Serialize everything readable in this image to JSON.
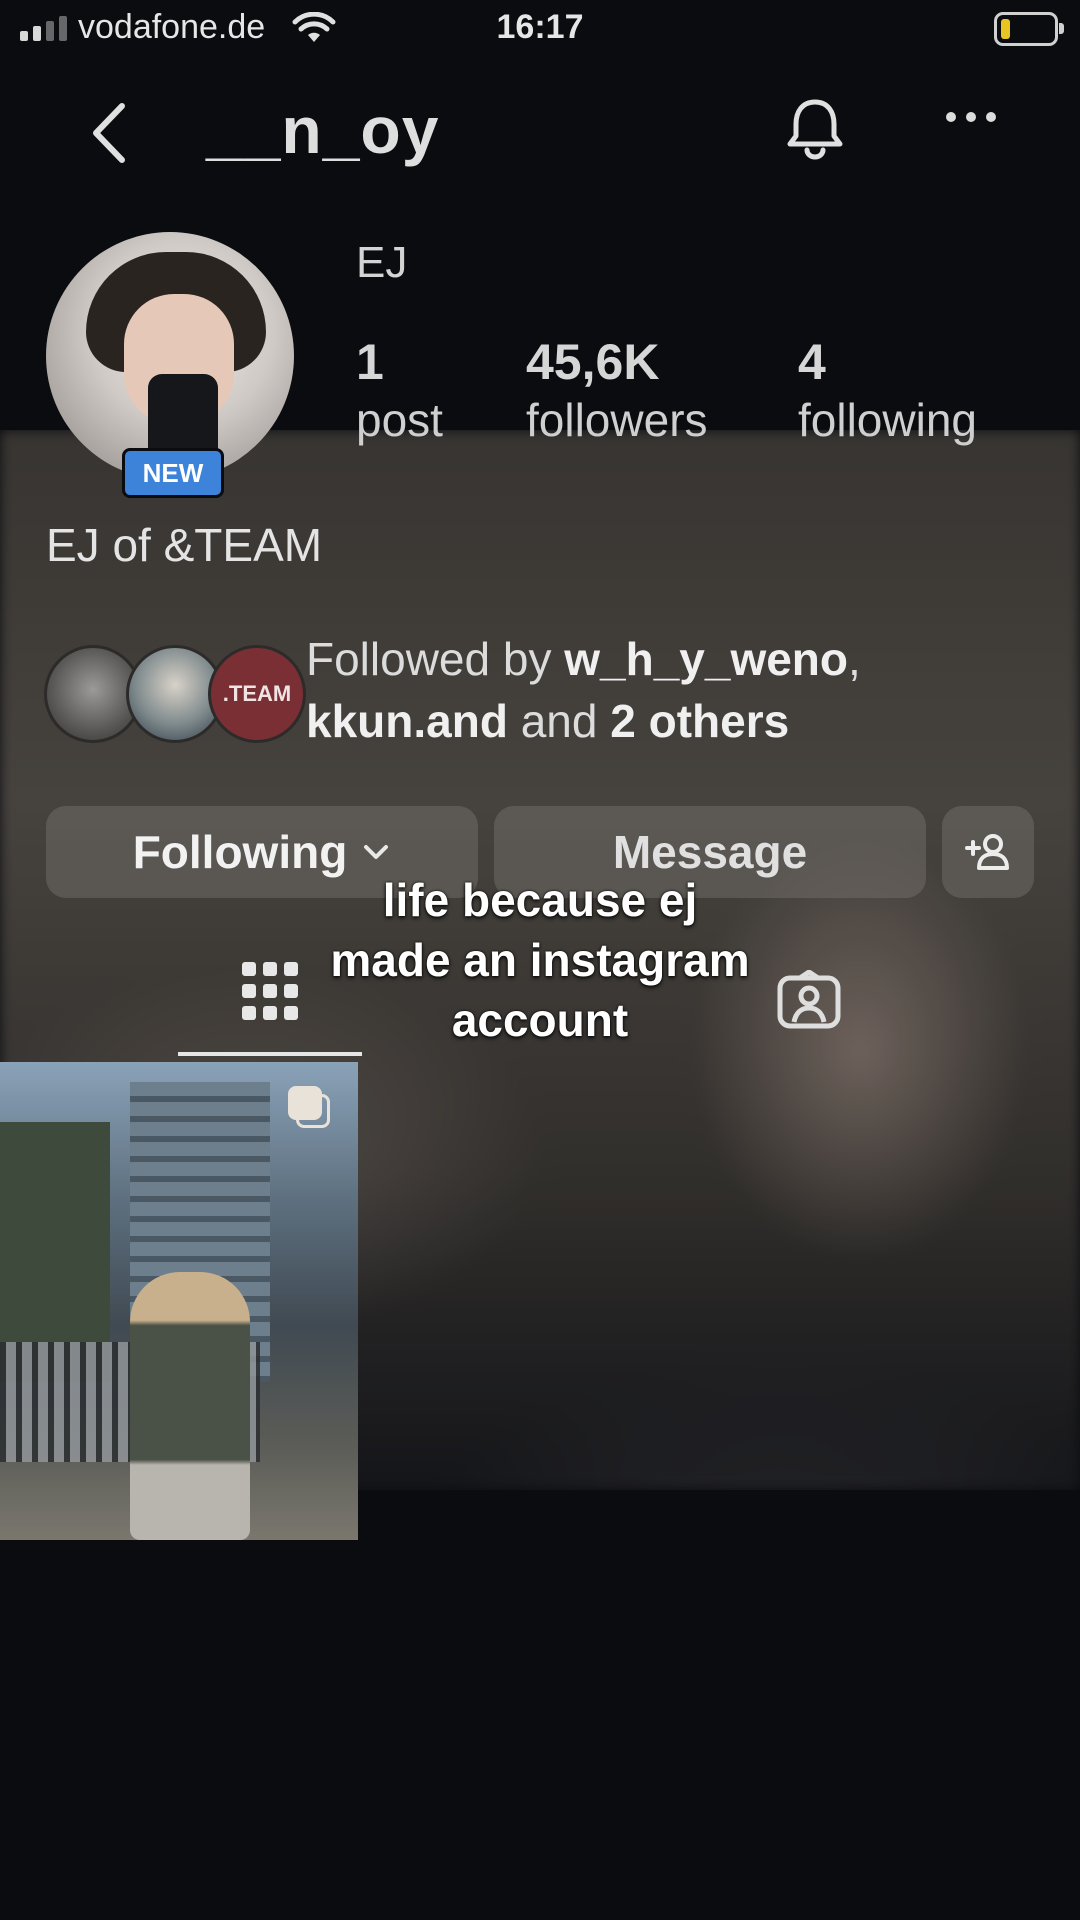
{
  "status_bar": {
    "carrier": "vodafone.de",
    "time": "16:17"
  },
  "header": {
    "username": "__n_oy"
  },
  "profile": {
    "display_name": "EJ",
    "badge": "NEW",
    "bio": "EJ of &TEAM",
    "stats": [
      {
        "value": "1",
        "label": "post"
      },
      {
        "value": "45,6K",
        "label": "followers"
      },
      {
        "value": "4",
        "label": "following"
      }
    ]
  },
  "followed_by": {
    "prefix": "Followed by ",
    "user1": "w_h_y_weno",
    "sep": ",",
    "user2": "kkun.and",
    "and": " and ",
    "others": "2 others",
    "avatar3_label": ".TEAM"
  },
  "actions": {
    "following_label": "Following",
    "message_label": "Message"
  },
  "caption": {
    "line1": "life because ej",
    "line2": "made an instagram",
    "line3": "account"
  },
  "icons": [
    "back-chevron-icon",
    "bell-icon",
    "more-icon",
    "chevron-down-icon",
    "add-user-icon",
    "grid-icon",
    "tagged-icon",
    "multiple-posts-icon"
  ]
}
